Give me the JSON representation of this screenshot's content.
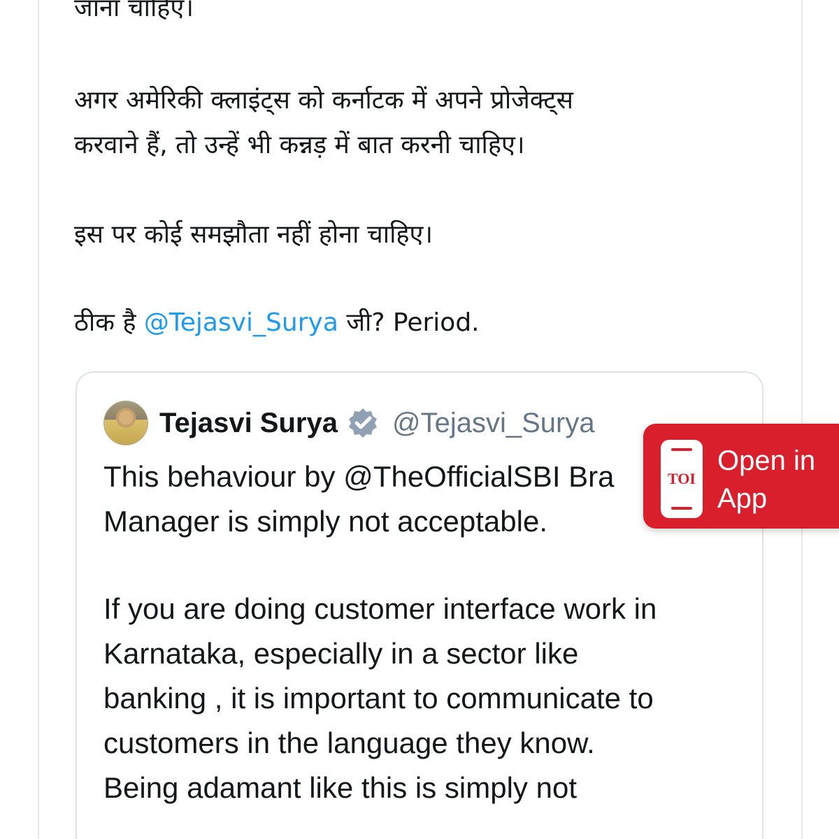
{
  "tweet": {
    "lines": [
      "जाना चाहिए।",
      "अगर अमेरिकी क्लाइंट्स को कर्नाटक में अपने प्रोजेक्ट्स",
      "करवाने हैं, तो उन्हें भी कन्नड़ में बात करनी चाहिए।",
      "इस पर कोई समझौता नहीं होना चाहिए।"
    ],
    "final_line": {
      "prefix": "ठीक है ",
      "mention": "@Tejasvi_Surya",
      "suffix": " जी? Period."
    }
  },
  "quoted_tweet": {
    "display_name": "Tejasvi Surya",
    "handle": "@Tejasvi_Surya",
    "verified": true,
    "text_lines": [
      "This behaviour by @TheOfficialSBI Bra",
      "Manager is simply not acceptable.",
      "If you are doing customer interface work in",
      "Karnataka, especially in a sector like",
      "banking , it is important to communicate to",
      "customers in the language they know.",
      "Being adamant like this is simply not"
    ]
  },
  "app_banner": {
    "logo_text": "TOI",
    "label": "Open in\nApp",
    "background": "#d91f2c"
  },
  "colors": {
    "text": "#14171a",
    "mention": "#1d9bf0",
    "muted": "#657786",
    "verified_badge": "#8fa1b3"
  },
  "icons": {
    "verified": "verified-badge-icon",
    "app": "phone-icon"
  }
}
